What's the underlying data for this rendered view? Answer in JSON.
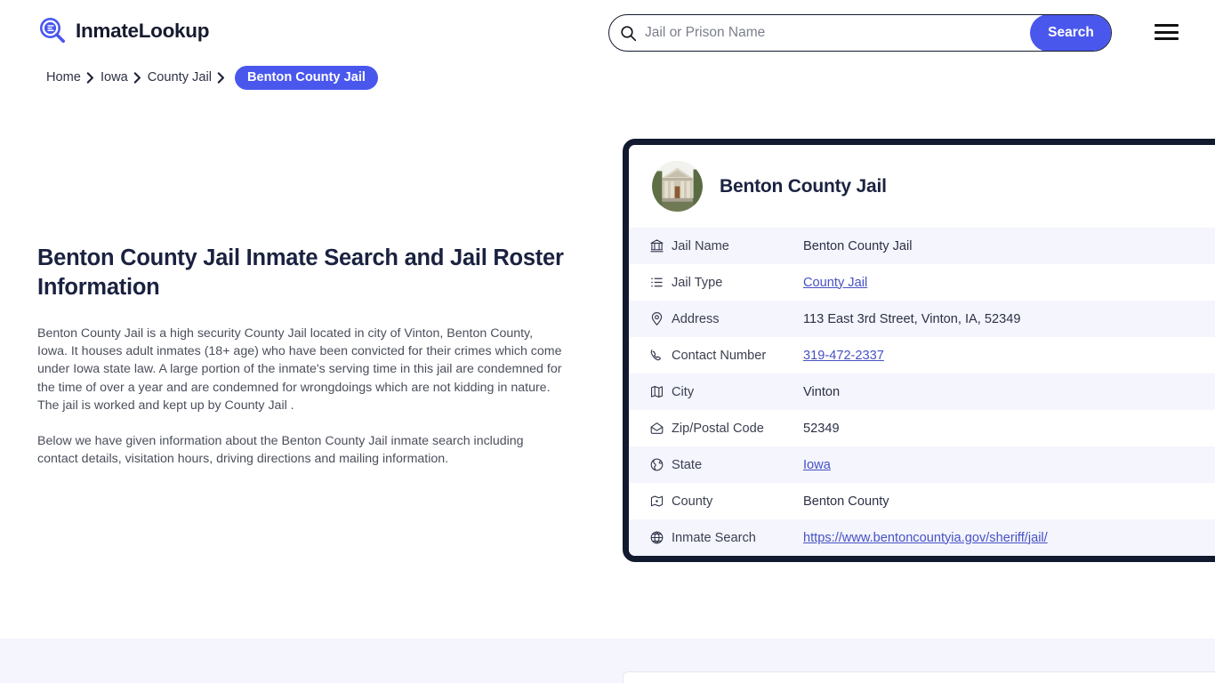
{
  "header": {
    "brand_name": "InmateLookup",
    "brand_logo_icon": "magnifier-list-logo-icon",
    "search": {
      "placeholder": "Jail or Prison Name",
      "value": "",
      "button_label": "Search",
      "icon": "search-icon"
    },
    "menu_icon": "hamburger-menu-icon",
    "accent_color": "#4a57ed"
  },
  "breadcrumb": {
    "items": [
      {
        "label": "Home",
        "current": false
      },
      {
        "label": "Iowa",
        "current": false
      },
      {
        "label": "County Jail",
        "current": false
      },
      {
        "label": "Benton County Jail",
        "current": true
      }
    ],
    "separator": "❯"
  },
  "main": {
    "title": "Benton County Jail Inmate Search and Jail Roster Information",
    "paragraphs": [
      "Benton County Jail is a high security County Jail located in city of Vinton, Benton County, Iowa. It houses adult inmates (18+ age) who have been convicted for their crimes which come under Iowa state law. A large portion of the inmate's serving time in this jail are condemned for the time of over a year and are condemned for wrongdoings which are not kidding in nature. The jail is worked and kept up by County Jail .",
      "Below we have given information about the Benton County Jail inmate search including contact details, visitation hours, driving directions and mailing information."
    ]
  },
  "info_card": {
    "title": "Benton County Jail",
    "avatar_icon": "courthouse-photo-avatar",
    "border_color": "#111a2e",
    "rows": [
      {
        "icon": "bank-icon",
        "label": "Jail Name",
        "value": "Benton County Jail",
        "link": false
      },
      {
        "icon": "list-icon",
        "label": "Jail Type",
        "value": "County Jail",
        "link": true
      },
      {
        "icon": "map-pin-icon",
        "label": "Address",
        "value": "113 East 3rd Street, Vinton, IA, 52349",
        "link": false
      },
      {
        "icon": "phone-icon",
        "label": "Contact Number",
        "value": "319-472-2337",
        "link": true
      },
      {
        "icon": "map-icon",
        "label": "City",
        "value": "Vinton",
        "link": false
      },
      {
        "icon": "envelope-icon",
        "label": "Zip/Postal Code",
        "value": "52349",
        "link": false
      },
      {
        "icon": "globe-icon",
        "label": "State",
        "value": "Iowa",
        "link": true
      },
      {
        "icon": "map-dot-icon",
        "label": "County",
        "value": "Benton County",
        "link": false
      },
      {
        "icon": "globe-grid-icon",
        "label": "Inmate Search",
        "value": "https://www.bentoncountyia.gov/sheriff/jail/",
        "link": true
      }
    ]
  }
}
